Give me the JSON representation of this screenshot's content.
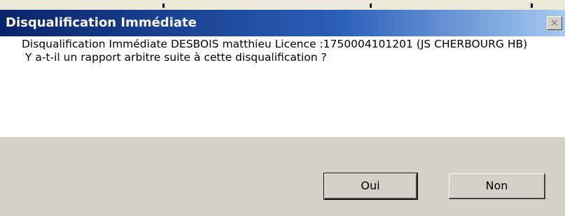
{
  "dialog": {
    "title": "Disqualification Immédiate",
    "close_icon": "close-icon",
    "message_line1": "Disqualification Immédiate DESBOIS matthieu Licence :1750004101201 (JS CHERBOURG HB)",
    "message_line2": " Y a-t-il un rapport arbitre suite à cette disqualification ?",
    "buttons": {
      "yes_label": "Oui",
      "no_label": "Non"
    }
  },
  "colors": {
    "titlebar_start": "#0a246a",
    "titlebar_end": "#a6caf0",
    "button_face": "#d4d0c8",
    "content_background": "#ffffff"
  }
}
